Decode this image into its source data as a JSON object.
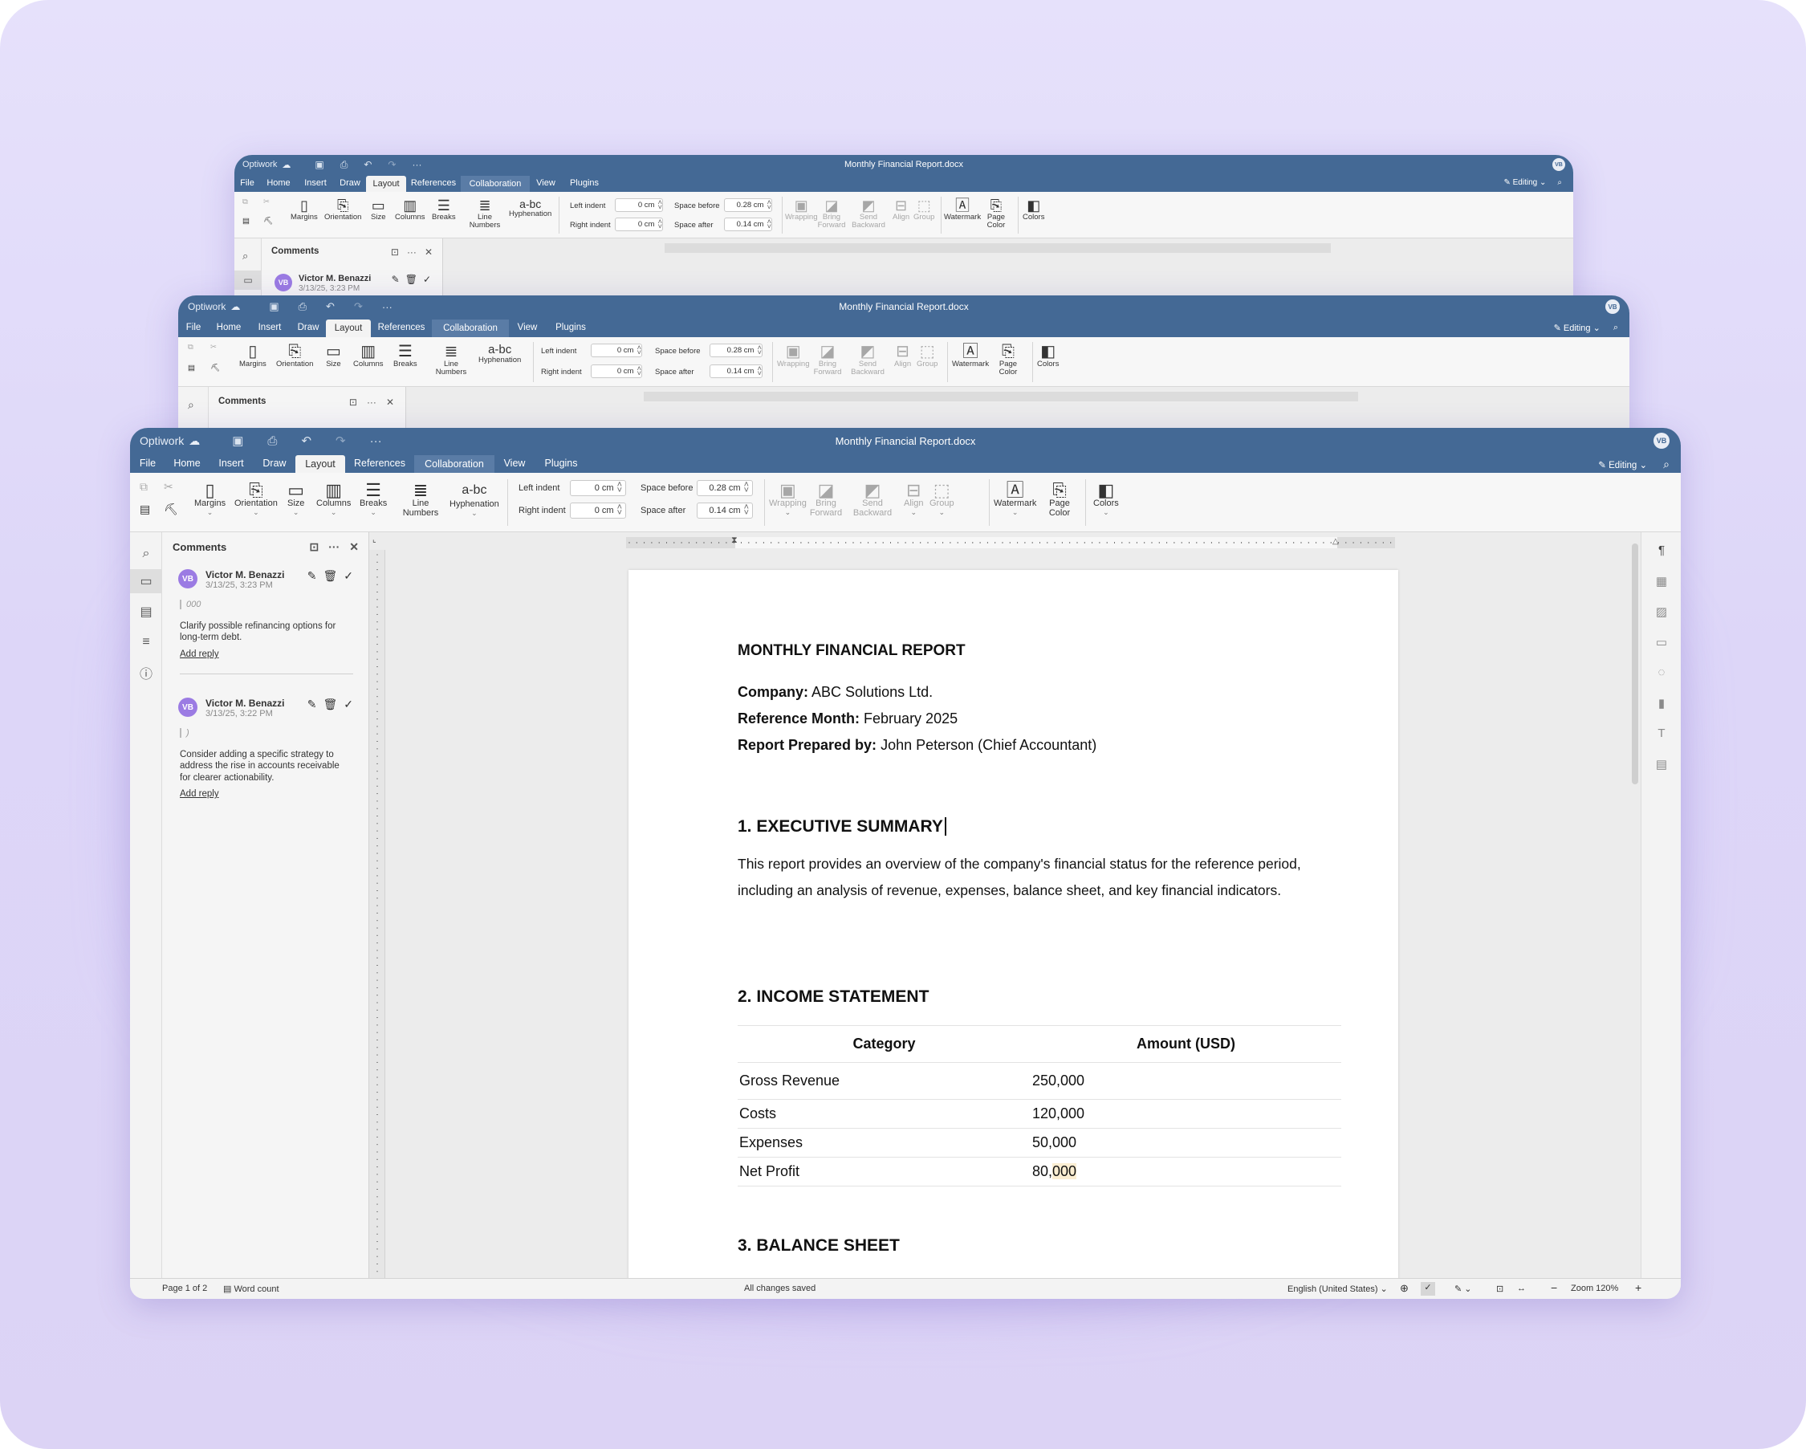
{
  "app": {
    "brand": "Optiwork",
    "doc_title": "Monthly Financial Report.docx",
    "avatar": "VB",
    "mode": "Editing"
  },
  "menu": {
    "file": "File",
    "home": "Home",
    "insert": "Insert",
    "draw": "Draw",
    "layout": "Layout",
    "references": "References",
    "collaboration": "Collaboration",
    "view": "View",
    "plugins": "Plugins"
  },
  "toolbar": {
    "margins": "Margins",
    "orientation": "Orientation",
    "size": "Size",
    "columns": "Columns",
    "breaks": "Breaks",
    "line_numbers": "Line Numbers",
    "hyphenation": "Hyphenation",
    "left_indent_label": "Left indent",
    "left_indent": "0 cm",
    "right_indent_label": "Right indent",
    "right_indent": "0 cm",
    "space_before_label": "Space before",
    "space_before": "0.28 cm",
    "space_after_label": "Space after",
    "space_after": "0.14 cm",
    "wrapping": "Wrapping",
    "bring_forward": "Bring Forward",
    "send_backward": "Send Backward",
    "align": "Align",
    "group": "Group",
    "watermark": "Watermark",
    "page_color": "Page Color",
    "colors": "Colors"
  },
  "comments": {
    "title": "Comments",
    "items": [
      {
        "avatar": "VB",
        "author": "Victor M. Benazzi",
        "time": "3/13/25, 3:23 PM",
        "quote": "000",
        "text": "Clarify possible refinancing options for long-term debt.",
        "reply": "Add reply"
      },
      {
        "avatar": "VB",
        "author": "Victor M. Benazzi",
        "time": "3/13/25, 3:22 PM",
        "quote": ")",
        "text": "Consider adding a specific strategy to address the rise in accounts receivable for clearer actionability.",
        "reply": "Add reply"
      }
    ]
  },
  "bg_comment": {
    "author": "Victor M. Benazzi",
    "time": "3/13/25, 3:23 PM"
  },
  "document": {
    "heading": "MONTHLY FINANCIAL REPORT",
    "company_label": "Company:",
    "company": "ABC Solutions Ltd.",
    "month_label": "Reference Month:",
    "month": "February 2025",
    "prepared_label": "Report Prepared by:",
    "prepared": "John Peterson (Chief Accountant)",
    "s1": "1. EXECUTIVE SUMMARY",
    "s1_text": "This report provides an overview of the company's financial status for the reference period, including an analysis of revenue, expenses, balance sheet, and key financial indicators.",
    "s2": "2. INCOME STATEMENT",
    "table": {
      "col1": "Category",
      "col2": "Amount (USD)",
      "rows": [
        {
          "cat": "Gross Revenue",
          "amt": "250,000"
        },
        {
          "cat": "Costs",
          "amt": "120,000"
        },
        {
          "cat": "Expenses",
          "amt": "50,000"
        },
        {
          "cat": "Net Profit",
          "amt_a": "80,",
          "amt_b": "000"
        }
      ]
    },
    "s3": "3. BALANCE SHEET"
  },
  "status": {
    "page": "Page 1 of 2",
    "word_count": "Word count",
    "saved": "All changes saved",
    "language": "English (United States)",
    "zoom": "Zoom 120%"
  },
  "colors": {
    "titlebar": "#446995",
    "avatar": "#9b7be3",
    "highlight": "#fbeed2"
  }
}
